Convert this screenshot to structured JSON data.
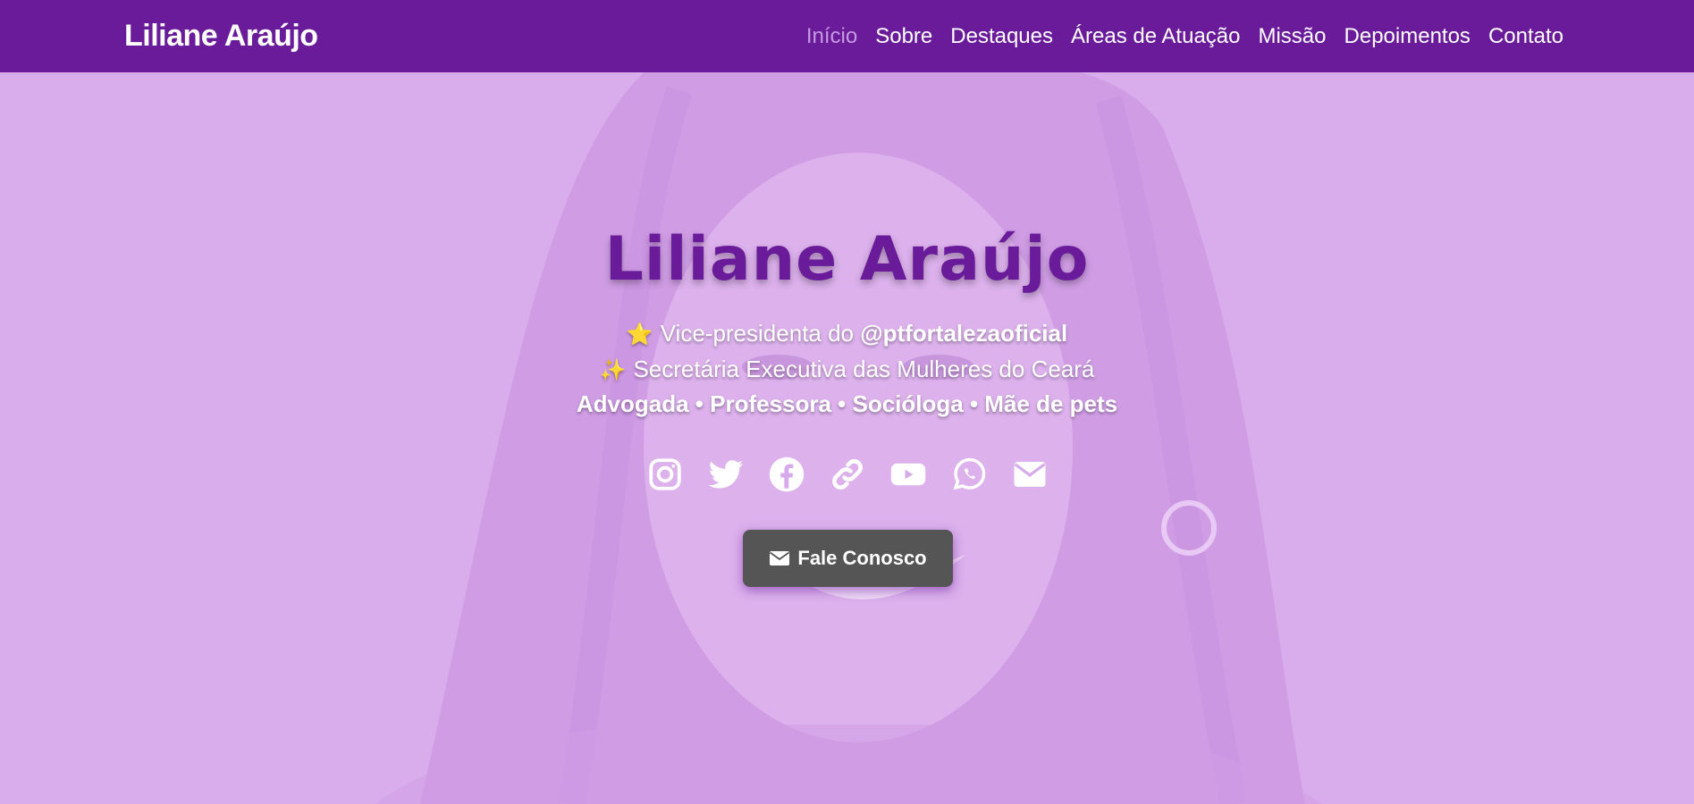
{
  "navbar": {
    "brand": "Liliane Araújo",
    "links": [
      {
        "label": "Início",
        "active": true
      },
      {
        "label": "Sobre"
      },
      {
        "label": "Destaques"
      },
      {
        "label": "Áreas de Atuação"
      },
      {
        "label": "Missão"
      },
      {
        "label": "Depoimentos"
      },
      {
        "label": "Contato"
      }
    ]
  },
  "hero": {
    "title": "Liliane Araújo",
    "line1": {
      "emoji": "⭐",
      "text": "Vice-presidenta do",
      "handle": "@ptfortalezaoficial"
    },
    "line2": {
      "emoji": "✨",
      "text": "Secretária Executiva das Mulheres do Ceará"
    },
    "line3": "Advogada • Professora • Socióloga • Mãe de pets",
    "socials": [
      "instagram-icon",
      "twitter-icon",
      "facebook-icon",
      "link-icon",
      "youtube-icon",
      "whatsapp-icon",
      "envelope-icon"
    ],
    "cta_label": "Fale Conosco",
    "cta_icon": "envelope-icon"
  },
  "colors": {
    "navbar_bg": "#6a1b9a",
    "nav_active": "#c59ae0",
    "hero_overlay": "#d7aaeb",
    "title": "#6a1b9a",
    "cta_bg": "#555555"
  }
}
